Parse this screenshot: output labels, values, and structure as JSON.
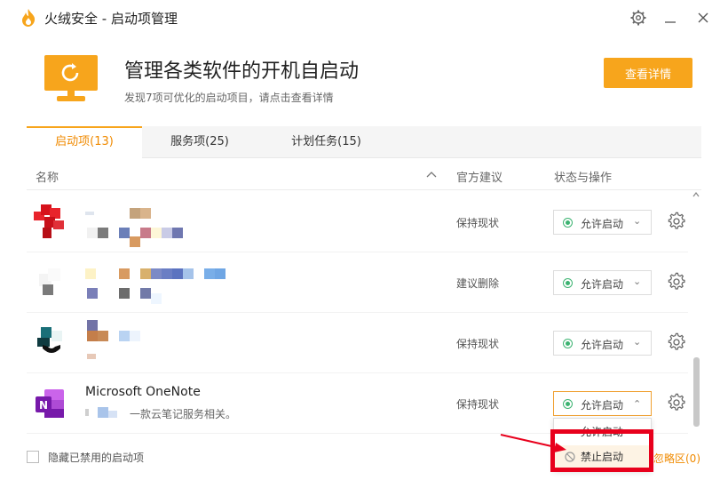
{
  "window": {
    "title": "火绒安全 - 启动项管理",
    "brand_color": "#f7a51c",
    "accent_color": "#f08a00"
  },
  "titlebar_icons": [
    "settings-icon",
    "minimize-icon",
    "close-icon"
  ],
  "hero": {
    "title": "管理各类软件的开机自启动",
    "subtitle": "发现7项可优化的启动项目，请点击查看详情",
    "detail_button": "查看详情"
  },
  "tabs": [
    {
      "label": "启动项(13)",
      "active": true
    },
    {
      "label": "服务项(25)",
      "active": false
    },
    {
      "label": "计划任务(15)",
      "active": false
    }
  ],
  "columns": {
    "name": "名称",
    "advice": "官方建议",
    "status": "状态与操作"
  },
  "rows": [
    {
      "name": "",
      "desc": "",
      "advice": "保持现状",
      "status": "允许启动",
      "icon": "red-app-icon"
    },
    {
      "name": "",
      "desc": "",
      "advice": "建议删除",
      "status": "允许启动",
      "icon": "white-app-icon"
    },
    {
      "name": "",
      "desc": "",
      "advice": "保持现状",
      "status": "允许启动",
      "icon": "teal-app-icon"
    },
    {
      "name": "Microsoft OneNote",
      "desc": "一款云笔记服务相关。",
      "advice": "保持现状",
      "status": "允许启动",
      "icon": "onenote-icon",
      "open": true
    }
  ],
  "dropdown": {
    "items": [
      "允许启动",
      "禁止启动"
    ]
  },
  "footer": {
    "hide_disabled": "隐藏已禁用的启动项",
    "optimized_link": "忽略区(0)"
  }
}
